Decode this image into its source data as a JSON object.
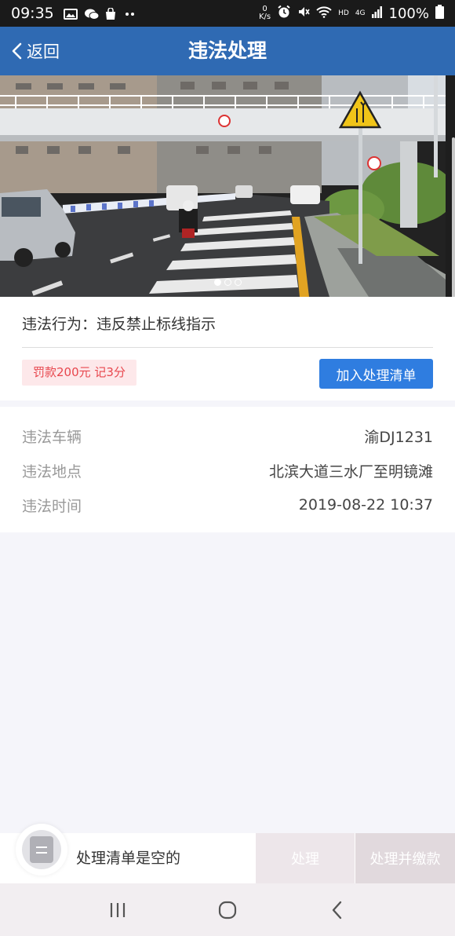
{
  "status_bar": {
    "time": "09:35",
    "speed_value": "0",
    "speed_unit": "K/s",
    "network": "HD",
    "cellular": "4G",
    "battery": "100%"
  },
  "header": {
    "back_label": "返回",
    "title": "违法处理"
  },
  "photo": {
    "page_count": 3,
    "active_index": 0
  },
  "violation": {
    "behavior_label": "违法行为：",
    "behavior_value": "违反禁止标线指示",
    "penalty": "罚款200元 记3分",
    "add_button": "加入处理清单"
  },
  "details": [
    {
      "label": "违法车辆",
      "value": "渝DJ1231"
    },
    {
      "label": "违法地点",
      "value": "北滨大道三水厂至明镜滩"
    },
    {
      "label": "违法时间",
      "value": "2019-08-22 10:37"
    }
  ],
  "action_bar": {
    "empty_text": "处理清单是空的",
    "process_button": "处理",
    "process_pay_button": "处理并缴款"
  },
  "nav": {
    "recents_icon": "recents-icon",
    "home_icon": "home-icon",
    "back_icon": "back-icon"
  },
  "colors": {
    "header": "#2f6ab3",
    "primary_button": "#2f7de0",
    "penalty_text": "#e8474e",
    "penalty_bg": "#fde8ea"
  }
}
